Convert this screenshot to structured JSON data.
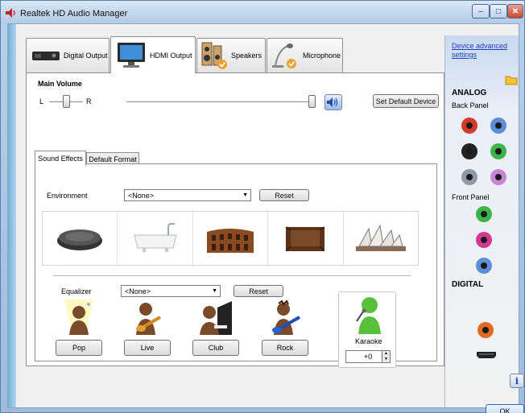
{
  "window": {
    "title": "Realtek HD Audio Manager",
    "caption_minimize": "–",
    "caption_maximize": "□",
    "caption_close": "✕"
  },
  "tabs": [
    {
      "label": "Digital Output",
      "icon": "digital-output-icon",
      "active": false
    },
    {
      "label": "HDMI Output",
      "icon": "hdmi-monitor-icon",
      "active": true
    },
    {
      "label": "Speakers",
      "icon": "speakers-icon",
      "active": false
    },
    {
      "label": "Microphone",
      "icon": "microphone-icon",
      "active": false
    }
  ],
  "volume": {
    "title": "Main Volume",
    "left_label": "L",
    "right_label": "R",
    "balance": 0.5,
    "level": 1.0,
    "set_default_label": "Set Default Device"
  },
  "subtabs": [
    {
      "label": "Sound Effects",
      "active": true
    },
    {
      "label": "Default Format",
      "active": false
    }
  ],
  "environment": {
    "label": "Environment",
    "selected": "<None>",
    "reset_label": "Reset",
    "presets": [
      "stone-disc-icon",
      "bathtub-icon",
      "colosseum-icon",
      "wooden-room-icon",
      "opera-house-icon"
    ]
  },
  "equalizer": {
    "label": "Equalizer",
    "selected": "<None>",
    "reset_label": "Reset",
    "presets": [
      {
        "label": "Pop",
        "icon": "pop-singer-icon"
      },
      {
        "label": "Live",
        "icon": "live-guitarist-icon"
      },
      {
        "label": "Club",
        "icon": "club-pianist-icon"
      },
      {
        "label": "Rock",
        "icon": "rock-guitarist-icon"
      }
    ]
  },
  "karaoke": {
    "label": "Karaoke",
    "value": "+0"
  },
  "right_panel": {
    "link_line1": "Device advanced",
    "link_line2": "settings",
    "analog_label": "ANALOG",
    "back_panel_label": "Back Panel",
    "front_panel_label": "Front Panel",
    "digital_label": "DIGITAL",
    "ok_label": "OK",
    "colors": {
      "accent": "#1a3fbf",
      "jack_red": "#d8392b",
      "jack_blue": "#5b8ed6",
      "jack_black": "#222222",
      "jack_green": "#3cb44a",
      "jack_gray": "#8f9aa8",
      "jack_pink": "#c786d4",
      "jack_magenta": "#d23a8f",
      "jack_orange": "#e06a1e"
    }
  }
}
